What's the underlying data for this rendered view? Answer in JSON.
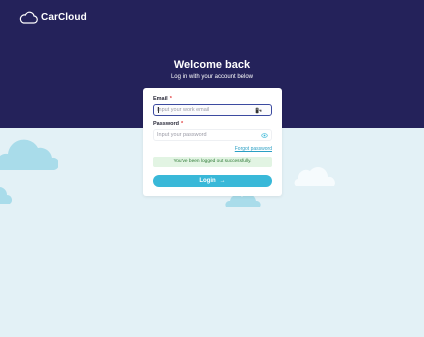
{
  "brand": {
    "name": "CarCloud",
    "logo_icon": "cloud-icon"
  },
  "page": {
    "title": "Welcome back",
    "subtitle": "Log in with your account below"
  },
  "form": {
    "email_label": "Email",
    "required_marker": "*",
    "email_placeholder": "Input your work email",
    "email_value": "",
    "password_label": "Password",
    "password_placeholder": "Input your password",
    "password_value": "",
    "forgot_password": "Forgot password",
    "logout_message": "You've been logged out successfully.",
    "login_label": "Login",
    "login_arrow": "→"
  },
  "colors": {
    "hero": "#24225a",
    "background": "#e3f1f6",
    "accent": "#39b8d8",
    "success_bg": "#e2f4e3",
    "success_text": "#2e7a36",
    "required": "#e23b3b"
  }
}
